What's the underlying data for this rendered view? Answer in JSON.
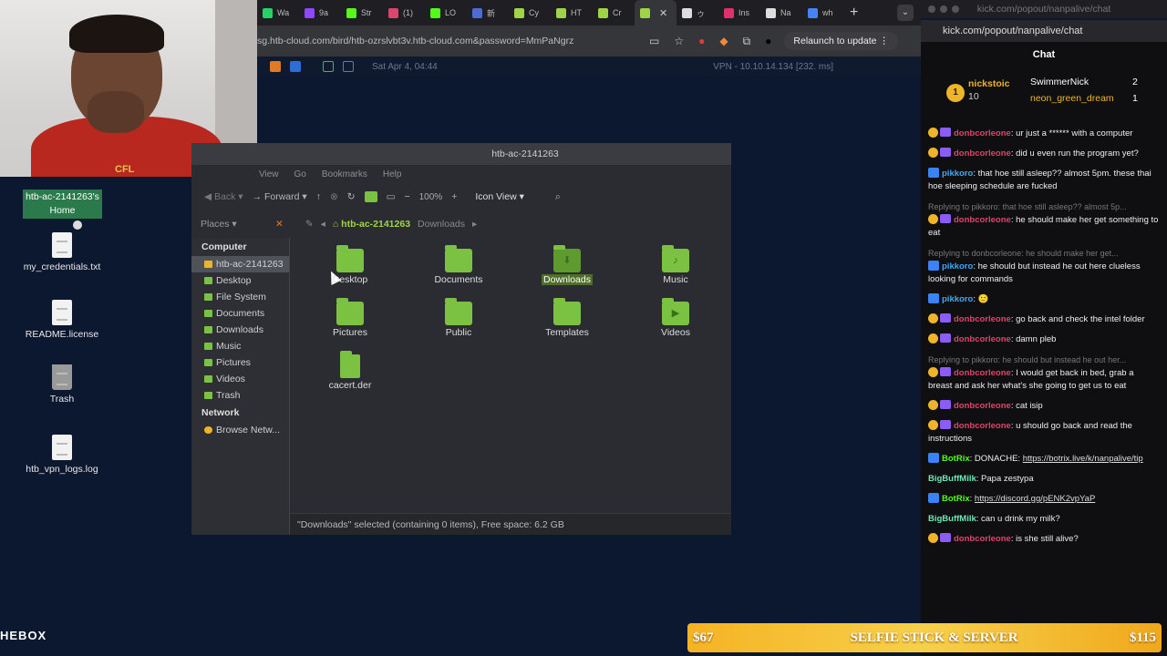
{
  "browser": {
    "tabs": [
      {
        "label": "Wa",
        "color": "#25d366"
      },
      {
        "label": "9a",
        "color": "#9146ff"
      },
      {
        "label": "Str",
        "color": "#53fc18"
      },
      {
        "label": "(1)",
        "color": "#e0436b"
      },
      {
        "label": "LO",
        "color": "#53fc18"
      },
      {
        "label": "新",
        "color": "#4a6cd4"
      },
      {
        "label": "Cy",
        "color": "#9fd446"
      },
      {
        "label": "HT",
        "color": "#9fd446"
      },
      {
        "label": "Cr",
        "color": "#9fd446"
      },
      {
        "label": "",
        "color": "#9fd446"
      },
      {
        "label": "ゥ",
        "color": "#dddddd"
      },
      {
        "label": "Ins",
        "color": "#e1306c"
      },
      {
        "label": "Na",
        "color": "#dddddd"
      },
      {
        "label": "wh",
        "color": "#4285f4"
      }
    ],
    "url": "sg.htb-cloud.com/bird/htb-ozrslvbt3v.htb-cloud.com&password=MmPaNgrz",
    "relaunch_label": "Relaunch to update"
  },
  "remote_panel": {
    "clock": "Sat Apr 4, 04:44",
    "vpn": "VPN - 10.10.14.134 [232. ms]"
  },
  "webcam": {
    "shirt_text": "CFL"
  },
  "desktop": {
    "home_label": "htb-ac-2141263's Home",
    "items": [
      {
        "label": "my_credentials.txt"
      },
      {
        "label": "README.license"
      },
      {
        "label": "Trash"
      },
      {
        "label": "htb_vpn_logs.log"
      }
    ],
    "watermark": "HEBOX"
  },
  "file_manager": {
    "title": "htb-ac-2141263",
    "menu": [
      "View",
      "Go",
      "Bookmarks",
      "Help"
    ],
    "toolbar": {
      "back": "Back",
      "forward": "Forward",
      "zoom": "100%",
      "view_mode": "Icon View"
    },
    "places_label": "Places",
    "breadcrumb": [
      "htb-ac-2141263",
      "Downloads"
    ],
    "sidebar": {
      "computer_heading": "Computer",
      "computer_items": [
        "htb-ac-2141263",
        "Desktop",
        "File System",
        "Documents",
        "Downloads",
        "Music",
        "Pictures",
        "Videos",
        "Trash"
      ],
      "network_heading": "Network",
      "network_items": [
        "Browse Netw..."
      ]
    },
    "items": [
      {
        "label": "Desktop",
        "glyph": ""
      },
      {
        "label": "Documents",
        "glyph": ""
      },
      {
        "label": "Downloads",
        "glyph": "⬇"
      },
      {
        "label": "Music",
        "glyph": "♪"
      },
      {
        "label": "Pictures",
        "glyph": ""
      },
      {
        "label": "Public",
        "glyph": ""
      },
      {
        "label": "Templates",
        "glyph": ""
      },
      {
        "label": "Videos",
        "glyph": "▶"
      },
      {
        "label": "cacert.der",
        "glyph": ""
      }
    ],
    "status": "\"Downloads\" selected (containing 0 items), Free space: 6.2 GB"
  },
  "chat": {
    "window_title": "kick.com/popout/nanpalive/chat",
    "url": "kick.com/popout/nanpalive/chat",
    "title": "Chat",
    "leaderboard": [
      {
        "rank": "1",
        "name": "nickstoic",
        "count": "10"
      },
      {
        "name": "SwimmerNick",
        "count": "2"
      },
      {
        "name": "neon_green_dream",
        "count": "1"
      }
    ],
    "messages": [
      {
        "user": "donbcorleone",
        "kind": "don",
        "text": ": ur just a ****** with a computer"
      },
      {
        "user": "donbcorleone",
        "kind": "don",
        "text": ": did u even run the program yet?"
      },
      {
        "user": "pikkoro",
        "kind": "pik",
        "text": ": that hoe still asleep?? almost 5pm. these thai hoe sleeping schedule are fucked"
      },
      {
        "reply": "Replying to pikkoro: that hoe still asleep?? almost 5p...",
        "user": "donbcorleone",
        "kind": "don",
        "text": ": he should make her get something to eat"
      },
      {
        "reply": "Replying to donbcorleone: he should make her get...",
        "user": "pikkoro",
        "kind": "pik",
        "text": ": he should but instead he out here clueless looking for commands"
      },
      {
        "user": "pikkoro",
        "kind": "pik",
        "text": ": 🙂"
      },
      {
        "user": "donbcorleone",
        "kind": "don",
        "text": ": go back and check the intel folder"
      },
      {
        "user": "donbcorleone",
        "kind": "don",
        "text": ": damn pleb"
      },
      {
        "reply": "Replying to pikkoro: he should but instead he out her...",
        "user": "donbcorleone",
        "kind": "don",
        "text": ": I would get back in bed, grab a breast and ask her what's she going to get us to eat"
      },
      {
        "user": "donbcorleone",
        "kind": "don",
        "text": ": cat isip"
      },
      {
        "user": "donbcorleone",
        "kind": "don",
        "text": ": u should go back and read the instructions"
      },
      {
        "user": "BotRix",
        "kind": "bot",
        "text": ": DONACHE: ",
        "link": "https://botrix.live/k/nanpalive/tip"
      },
      {
        "user": "BigBuffMilk",
        "kind": "big",
        "text": ": Papa zestypa"
      },
      {
        "user": "BotRix",
        "kind": "bot",
        "text": ": ",
        "link": "https://discord.gg/pENK2vpYaP"
      },
      {
        "user": "BigBuffMilk",
        "kind": "big",
        "text": ": can u drink my milk?"
      },
      {
        "user": "donbcorleone",
        "kind": "don",
        "text": ": is she still alive?"
      }
    ]
  },
  "ticker": {
    "left": "$67",
    "middle": "SELFIE STICK & SERVER",
    "right": "$115"
  }
}
